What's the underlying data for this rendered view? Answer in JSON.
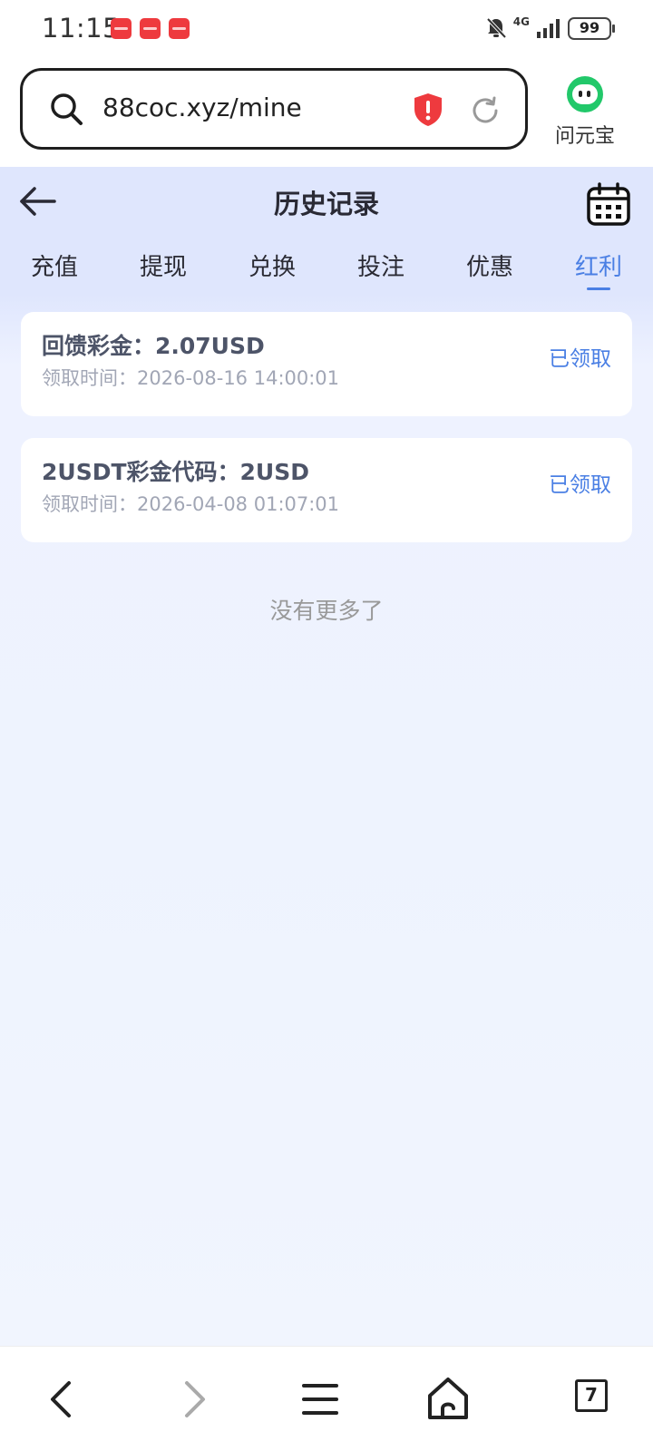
{
  "status_bar": {
    "time": "11:15",
    "network": "4G",
    "battery": "99"
  },
  "browser": {
    "url": "88coc.xyz/mine",
    "ai_label": "问元宝"
  },
  "header": {
    "title": "历史记录"
  },
  "tabs": [
    {
      "label": "充值",
      "active": false
    },
    {
      "label": "提现",
      "active": false
    },
    {
      "label": "兑换",
      "active": false
    },
    {
      "label": "投注",
      "active": false
    },
    {
      "label": "优惠",
      "active": false
    },
    {
      "label": "红利",
      "active": true
    }
  ],
  "records": [
    {
      "title": "回馈彩金：2.07USD",
      "time_label": "领取时间：",
      "time": "2026-08-16 14:00:01",
      "status": "已领取"
    },
    {
      "title": "2USDT彩金代码：2USD",
      "time_label": "领取时间：",
      "time": "2026-04-08 01:07:01",
      "status": "已领取"
    }
  ],
  "footer_text": "没有更多了",
  "bottom_nav": {
    "tab_count": "7"
  },
  "colors": {
    "accent": "#4a7fe4",
    "header_bg": "#dfe6fd",
    "warning": "#ee3a3e",
    "ai_green": "#22c86a"
  }
}
